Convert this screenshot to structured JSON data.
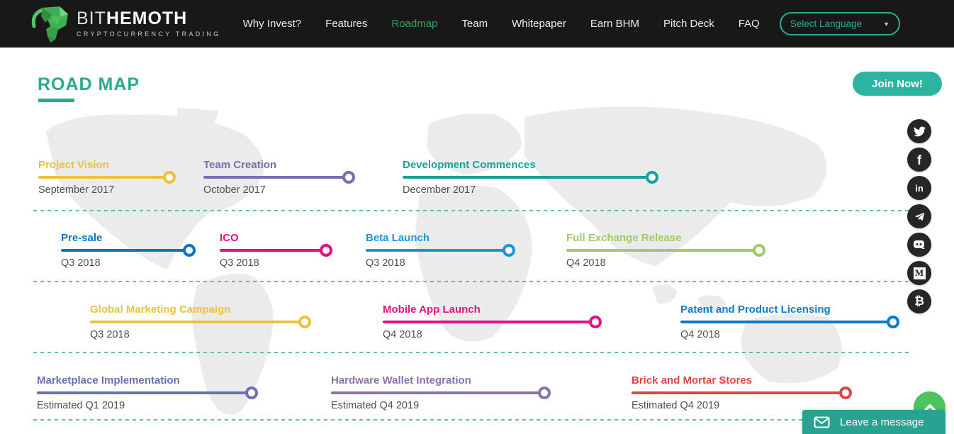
{
  "header": {
    "logo": {
      "brand_thin": "BIT",
      "brand_bold": "HEMOTH",
      "tagline": "CRYPTOCURRENCY TRADING"
    },
    "nav": [
      {
        "label": "Why Invest?",
        "active": false
      },
      {
        "label": "Features",
        "active": false
      },
      {
        "label": "Roadmap",
        "active": true
      },
      {
        "label": "Team",
        "active": false
      },
      {
        "label": "Whitepaper",
        "active": false
      },
      {
        "label": "Earn BHM",
        "active": false
      },
      {
        "label": "Pitch Deck",
        "active": false
      },
      {
        "label": "FAQ",
        "active": false
      }
    ],
    "language_selector": {
      "value": "Select Language",
      "arrow": "▼"
    }
  },
  "hero": {
    "title": "ROAD MAP",
    "join_button": "Join Now!"
  },
  "social": [
    "twitter",
    "facebook",
    "linkedin",
    "telegram",
    "discord",
    "medium",
    "bitcoin"
  ],
  "roadmap": {
    "rows": [
      {
        "items": [
          {
            "title": "Project Vision",
            "date": "September 2017",
            "color": "#ecc23d"
          },
          {
            "title": "Team Creation",
            "date": "October 2017",
            "color": "#7470ad"
          },
          {
            "title": "Development Commences",
            "date": "December 2017",
            "color": "#15a29c"
          }
        ]
      },
      {
        "items": [
          {
            "title": "Pre-sale",
            "date": "Q3 2018",
            "color": "#0d74bf"
          },
          {
            "title": "ICO",
            "date": "Q3 2018",
            "color": "#e40e7f"
          },
          {
            "title": "Beta Launch",
            "date": "Q3 2018",
            "color": "#1e95d3"
          },
          {
            "title": "Full Exchange Release",
            "date": "Q4 2018",
            "color": "#a2ca6a"
          }
        ]
      },
      {
        "items": [
          {
            "title": "Global Marketing Campaign",
            "date": "Q3 2018",
            "color": "#ecc23d"
          },
          {
            "title": "Mobile App Launch",
            "date": "Q4 2018",
            "color": "#e01483"
          },
          {
            "title": "Patent and Product Licensing",
            "date": "Q4 2018",
            "color": "#0d7cc7"
          }
        ]
      },
      {
        "items": [
          {
            "title": "Marketplace Implementation",
            "date": "Estimated Q1 2019",
            "color": "#6a70b2"
          },
          {
            "title": "Hardware Wallet Integration",
            "date": "Estimated Q4 2019",
            "color": "#8973a8"
          },
          {
            "title": "Brick and Mortar Stores",
            "date": "Estimated Q4 2019",
            "color": "#d64949"
          }
        ]
      }
    ]
  },
  "chat": {
    "label": "Leave a message"
  },
  "colors": {
    "header_bg": "#181818",
    "nav_active_green": "#2aa85f",
    "accent_teal": "#2bae96",
    "title_teal": "#2aa98c",
    "join_button": "#2db4a0",
    "dashed_separator": "#2fae74",
    "chat_bg": "#27a392",
    "scroll_button": "#4bc55f",
    "date_text": "#4f4f4f"
  }
}
